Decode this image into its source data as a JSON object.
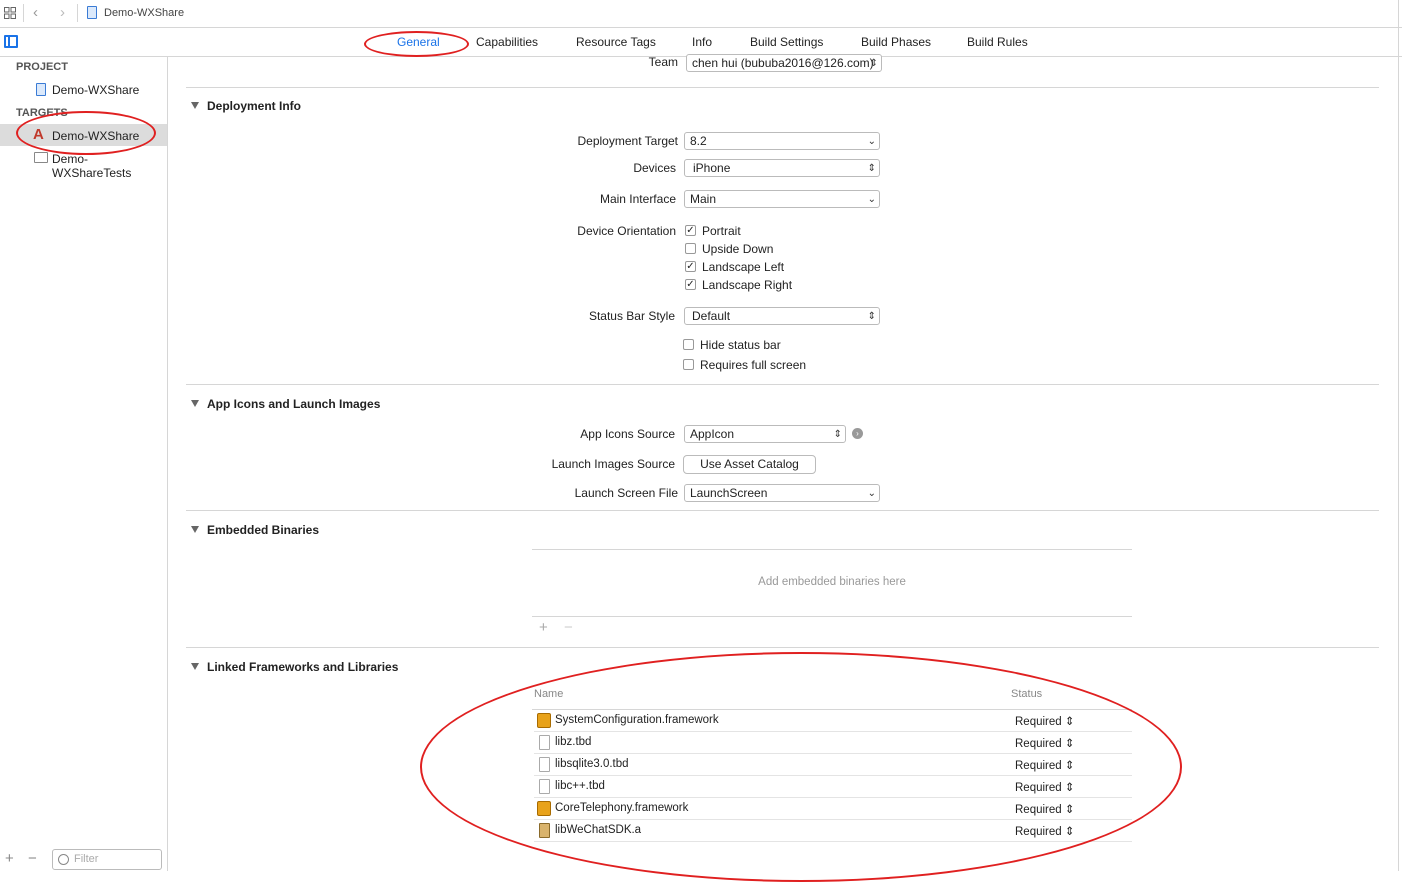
{
  "toolbar": {
    "breadcrumb": "Demo-WXShare"
  },
  "tabs": [
    {
      "label": "General",
      "active": true
    },
    {
      "label": "Capabilities"
    },
    {
      "label": "Resource Tags"
    },
    {
      "label": "Info"
    },
    {
      "label": "Build Settings"
    },
    {
      "label": "Build Phases"
    },
    {
      "label": "Build Rules"
    }
  ],
  "sidebar": {
    "project_header": "PROJECT",
    "project_item": "Demo-WXShare",
    "targets_header": "TARGETS",
    "targets": [
      "Demo-WXShare",
      "Demo-WXShareTests"
    ],
    "filter_placeholder": "Filter"
  },
  "identity": {
    "team_label": "Team",
    "team_value": "chen hui (bububa2016@126.com)"
  },
  "deployment": {
    "title": "Deployment Info",
    "target_label": "Deployment Target",
    "target_value": "8.2",
    "devices_label": "Devices",
    "devices_value": "iPhone",
    "main_interface_label": "Main Interface",
    "main_interface_value": "Main",
    "orientation_label": "Device Orientation",
    "orientations": [
      {
        "label": "Portrait",
        "checked": true
      },
      {
        "label": "Upside Down",
        "checked": false
      },
      {
        "label": "Landscape Left",
        "checked": true
      },
      {
        "label": "Landscape Right",
        "checked": true
      }
    ],
    "status_bar_label": "Status Bar Style",
    "status_bar_value": "Default",
    "hide_status_bar": "Hide status bar",
    "requires_full_screen": "Requires full screen"
  },
  "icons": {
    "title": "App Icons and Launch Images",
    "app_icons_label": "App Icons Source",
    "app_icons_value": "AppIcon",
    "launch_images_label": "Launch Images Source",
    "launch_images_button": "Use Asset Catalog",
    "launch_screen_label": "Launch Screen File",
    "launch_screen_value": "LaunchScreen"
  },
  "embedded": {
    "title": "Embedded Binaries",
    "placeholder": "Add embedded binaries here",
    "add": "+",
    "remove": "−"
  },
  "linked": {
    "title": "Linked Frameworks and Libraries",
    "col_name": "Name",
    "col_status": "Status",
    "rows": [
      {
        "name": "SystemConfiguration.framework",
        "status": "Required",
        "icon": "framework-icon"
      },
      {
        "name": "libz.tbd",
        "status": "Required",
        "icon": "file-icon"
      },
      {
        "name": "libsqlite3.0.tbd",
        "status": "Required",
        "icon": "file-icon"
      },
      {
        "name": "libc++.tbd",
        "status": "Required",
        "icon": "file-icon"
      },
      {
        "name": "CoreTelephony.framework",
        "status": "Required",
        "icon": "framework-icon"
      },
      {
        "name": "libWeChatSDK.a",
        "status": "Required",
        "icon": "library-icon"
      }
    ]
  },
  "colors": {
    "accent": "#1a73e8",
    "annotation": "#e02020"
  }
}
